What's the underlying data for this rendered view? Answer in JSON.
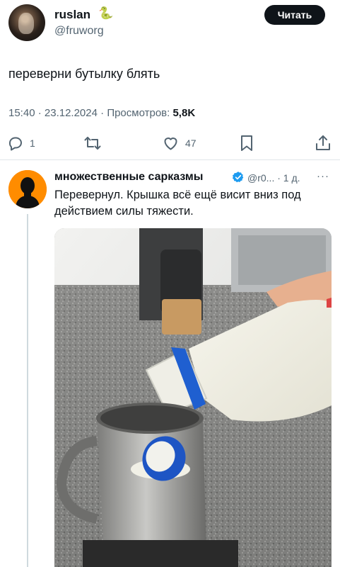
{
  "tweet": {
    "author_name": "ruslan",
    "author_emoji": "🐍",
    "author_handle": "@fruworg",
    "follow_label": "Читать",
    "text": "переверни бутылку блять",
    "time": "15:40",
    "date": "23.12.2024",
    "views_label": "Просмотров:",
    "views_count": "5,8K",
    "actions": {
      "reply_count": "1",
      "retweet_count": "",
      "like_count": "47"
    }
  },
  "reply": {
    "author_name": "множественные сарказмы",
    "author_handle": "@r0...",
    "age": "1 д.",
    "more": "···",
    "text": "Перевернул. Крышка всё ещё висит вниз под действием силы тяжести."
  },
  "colors": {
    "text_primary": "#0f1419",
    "text_secondary": "#536471",
    "verified_blue": "#1d9bf0",
    "divider": "#e1e6ea",
    "avatar_orange": "#ff8c00"
  },
  "icons": {
    "reply": "comment-icon",
    "retweet": "retweet-icon",
    "like": "heart-icon",
    "bookmark": "bookmark-icon",
    "share": "share-icon",
    "verified": "verified-badge-icon"
  }
}
